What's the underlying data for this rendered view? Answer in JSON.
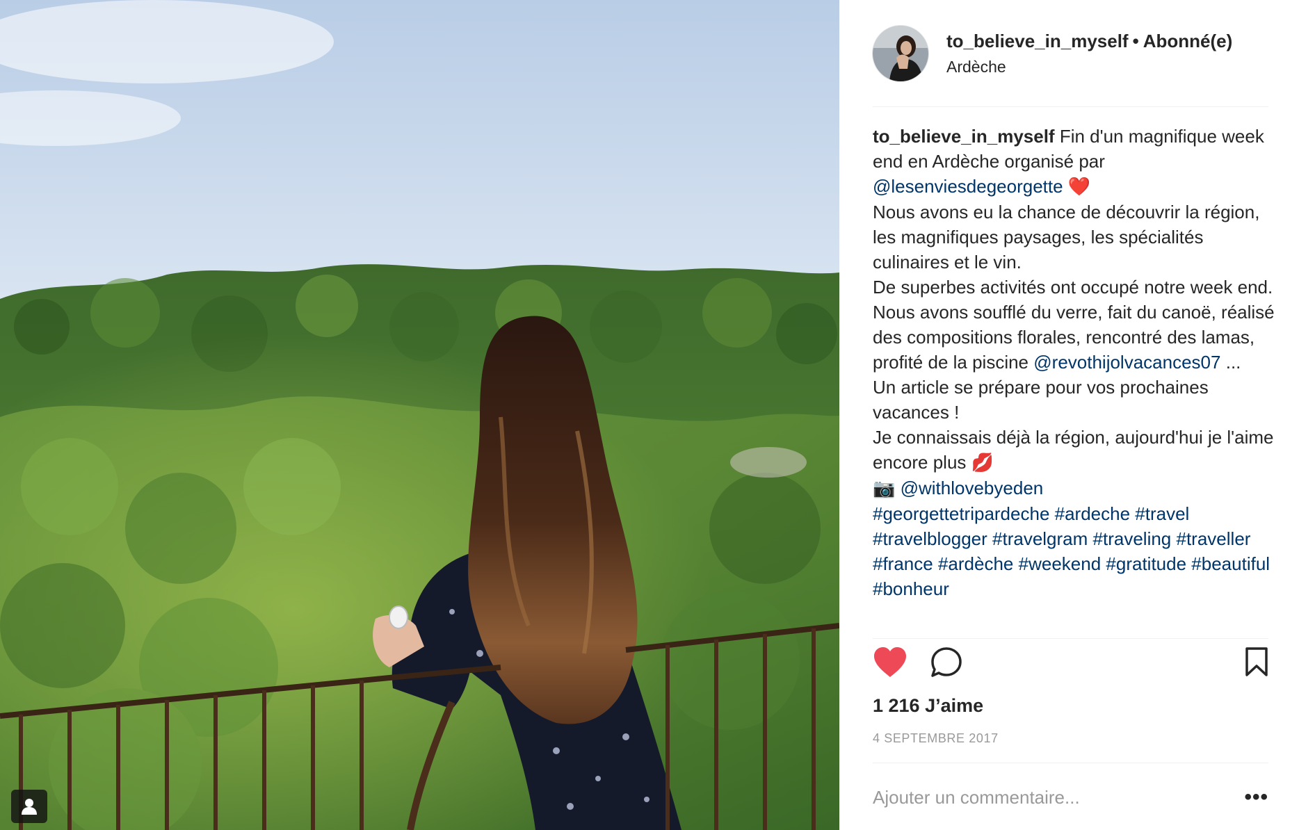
{
  "header": {
    "username": "to_believe_in_myself",
    "separator": "•",
    "follow_status": "Abonné(e)",
    "location": "Ardèche"
  },
  "caption": {
    "username": "to_believe_in_myself",
    "line1": "Fin d'un magnifique week end en Ardèche organisé par",
    "mention1": "@lesenviesdegeorgette",
    "emoji1": "❤️",
    "line2": "Nous avons eu la chance de découvrir la région, les magnifiques paysages, les spécialités culinaires et le vin.",
    "line3": "De superbes activités ont occupé notre week end. Nous avons soufflé du verre, fait du canoë, réalisé des compositions florales, rencontré des lamas, profité de la piscine",
    "mention2": "@revothijolvacances07",
    "ellipsis": "...",
    "line4": "Un article se prépare pour vos prochaines vacances !",
    "line5": "Je connaissais déjà la région, aujourd'hui je l'aime encore plus",
    "emoji2": "💋",
    "camera_emoji": "📷",
    "mention3": "@withlovebyeden",
    "hashtags": [
      "#georgettetripardeche",
      "#ardeche",
      "#travel",
      "#travelblogger",
      "#travelgram",
      "#traveling",
      "#traveller",
      "#france",
      "#ardèche",
      "#weekend",
      "#gratitude",
      "#beautiful",
      "#bonheur"
    ]
  },
  "actions": {
    "like_icon": "heart-filled-icon",
    "comment_icon": "comment-bubble-icon",
    "save_icon": "bookmark-icon",
    "liked": true,
    "like_color": "#ed4956"
  },
  "likes_text": "1 216 J’aime",
  "date": "4 SEPTEMBRE 2017",
  "comment": {
    "placeholder": "Ajouter un commentaire...",
    "more_label": "•••"
  },
  "photo": {
    "tag_icon": "user-tag-icon"
  }
}
